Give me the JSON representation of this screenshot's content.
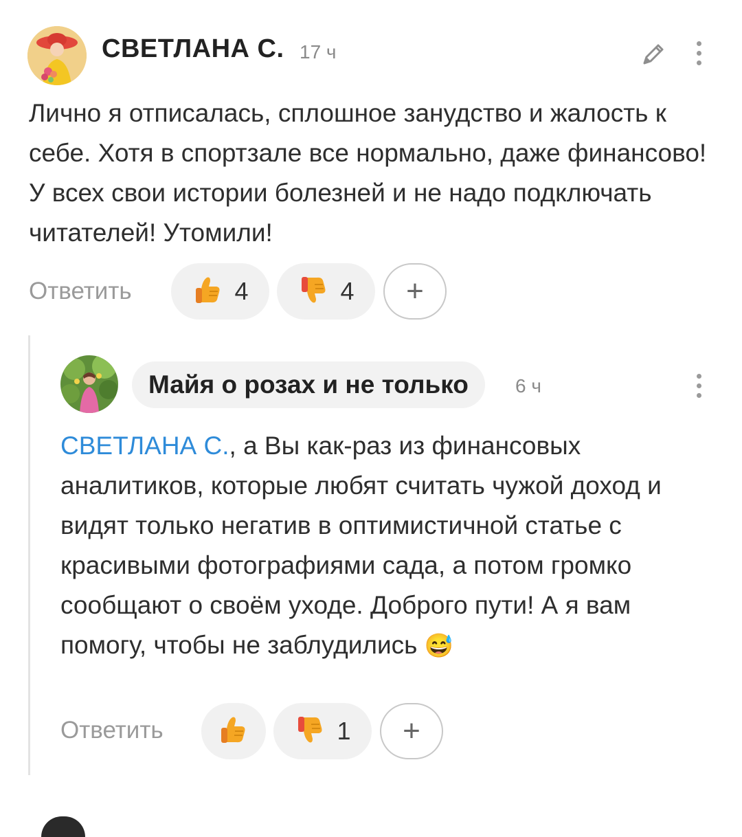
{
  "comment": {
    "author": "СВЕТЛАНА С.",
    "time": "17 ч",
    "text": "Лично я отписалась, сплошное занудство и жалость к себе. Хотя в спортзале все нормально, даже финансово! У всех свои истории болезней и не надо подключать читателей! Утомили!",
    "reply_label": "Ответить",
    "likes": "4",
    "dislikes": "4",
    "add_label": "+",
    "avatar_icon": "avatar-woman-in-red-hat",
    "edit_icon": "pencil-icon",
    "menu_icon": "more-vertical-icon"
  },
  "reply": {
    "author": "Майя о розах и не только",
    "time": "6 ч",
    "mention": "СВЕТЛАНА С.",
    "text": ", а Вы как-раз из финансовых аналитиков, которые любят считать чужой доход и видят только негатив в оптимистичной статье с красивыми фотографиями сада, а потом громко сообщают о своём уходе. Доброго пути! А я вам помогу, чтобы не заблудились",
    "emoji": "😅",
    "reply_label": "Ответить",
    "likes": "",
    "dislikes": "1",
    "add_label": "+",
    "avatar_icon": "avatar-woman-in-garden",
    "menu_icon": "more-vertical-icon"
  },
  "colors": {
    "mention": "#2e8bd9",
    "pill_bg": "#f1f1f1",
    "thumb": "#f5a623"
  }
}
